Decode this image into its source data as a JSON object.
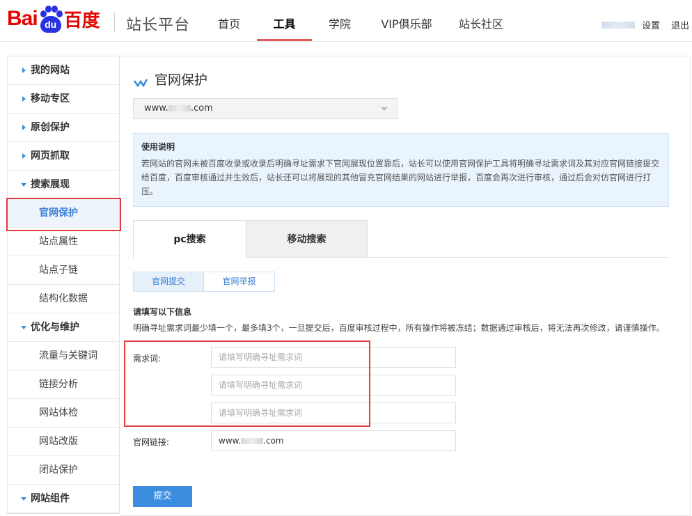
{
  "header": {
    "logo_left": "Bai",
    "logo_paw": "du",
    "logo_right": "百度",
    "site_title": "站长平台",
    "nav": [
      "首页",
      "工具",
      "学院",
      "VIP俱乐部",
      "站长社区"
    ],
    "active_nav": "工具",
    "settings": "设置",
    "logout": "退出"
  },
  "sidebar": {
    "items": [
      {
        "label": "我的网站",
        "type": "parent"
      },
      {
        "label": "移动专区",
        "type": "parent"
      },
      {
        "label": "原创保护",
        "type": "parent"
      },
      {
        "label": "网页抓取",
        "type": "parent"
      },
      {
        "label": "搜索展现",
        "type": "parent-open"
      },
      {
        "label": "官网保护",
        "type": "child-active"
      },
      {
        "label": "站点属性",
        "type": "child"
      },
      {
        "label": "站点子链",
        "type": "child"
      },
      {
        "label": "结构化数据",
        "type": "child"
      },
      {
        "label": "优化与维护",
        "type": "parent-open"
      },
      {
        "label": "流量与关键词",
        "type": "child"
      },
      {
        "label": "链接分析",
        "type": "child"
      },
      {
        "label": "网站体检",
        "type": "child"
      },
      {
        "label": "网站改版",
        "type": "child"
      },
      {
        "label": "闭站保护",
        "type": "child"
      },
      {
        "label": "网站组件",
        "type": "parent-open"
      }
    ]
  },
  "main": {
    "title": "官网保护",
    "site_select": {
      "prefix": "www.",
      "suffix": ".com"
    },
    "notice": {
      "title": "使用说明",
      "text": "若网站的官网未被百度收录或收录后明确寻址需求下官网展现位置靠后，站长可以使用官网保护工具将明确寻址需求词及其对应官网链接提交给百度，百度审核通过并生效后，站长还可以将展现的其他冒充官网结果的网站进行举报，百度会再次进行审核，通过后会对仿官网进行打压。"
    },
    "tabs": [
      "pc搜索",
      "移动搜索"
    ],
    "subtabs": [
      "官网提交",
      "官网举报"
    ],
    "form_heading": "请填写以下信息",
    "form_desc": "明确寻址需求词最少填一个，最多填3个，一旦提交后，百度审核过程中，所有操作将被冻结；数据通过审核后，将无法再次修改，请谨慎操作。",
    "keyword_label": "需求词:",
    "keyword_placeholder": "请填写明确寻址需求词",
    "url_label": "官网链接:",
    "url_value": {
      "prefix": "www.",
      "suffix": ".com"
    },
    "submit": "提交"
  }
}
